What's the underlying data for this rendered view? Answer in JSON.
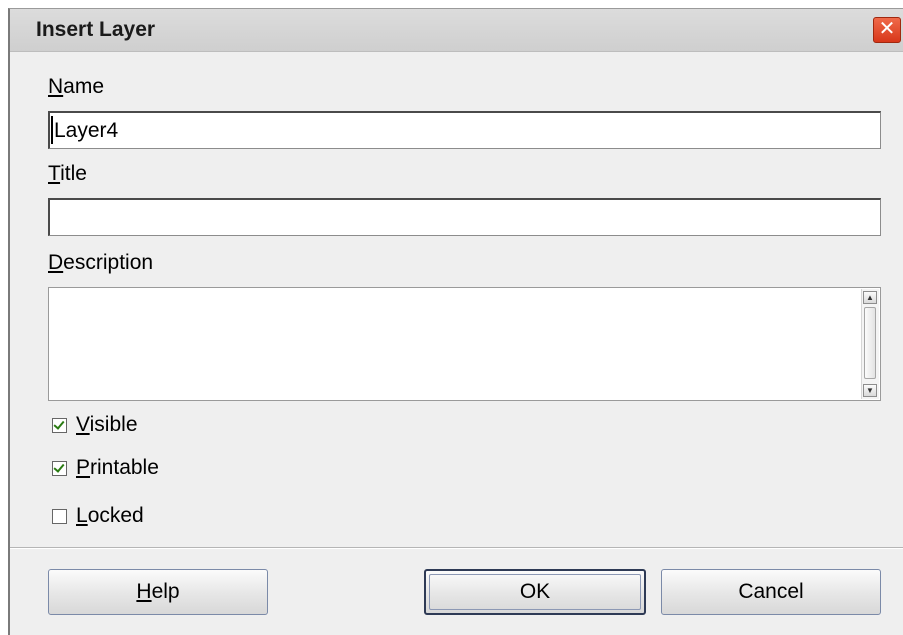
{
  "dialog": {
    "title": "Insert Layer",
    "close_label": "✕"
  },
  "fields": {
    "name": {
      "label_underlined": "N",
      "label_rest": "ame",
      "value": "Layer4"
    },
    "title": {
      "label_underlined": "T",
      "label_rest": "itle",
      "value": ""
    },
    "description": {
      "label_underlined": "D",
      "label_rest": "escription",
      "value": ""
    }
  },
  "checkboxes": [
    {
      "label_underlined": "V",
      "label_rest": "isible",
      "checked": true
    },
    {
      "label_underlined": "P",
      "label_rest": "rintable",
      "checked": true
    },
    {
      "label_underlined": "L",
      "label_rest": "ocked",
      "checked": false
    }
  ],
  "scrollbar": {
    "up_glyph": "▲",
    "down_glyph": "▼"
  },
  "buttons": {
    "help_underlined": "H",
    "help_rest": "elp",
    "ok": "OK",
    "cancel": "Cancel"
  },
  "colors": {
    "close_button": "#d8371a",
    "check_mark": "#2a7b12",
    "dialog_bg": "#efefef"
  }
}
